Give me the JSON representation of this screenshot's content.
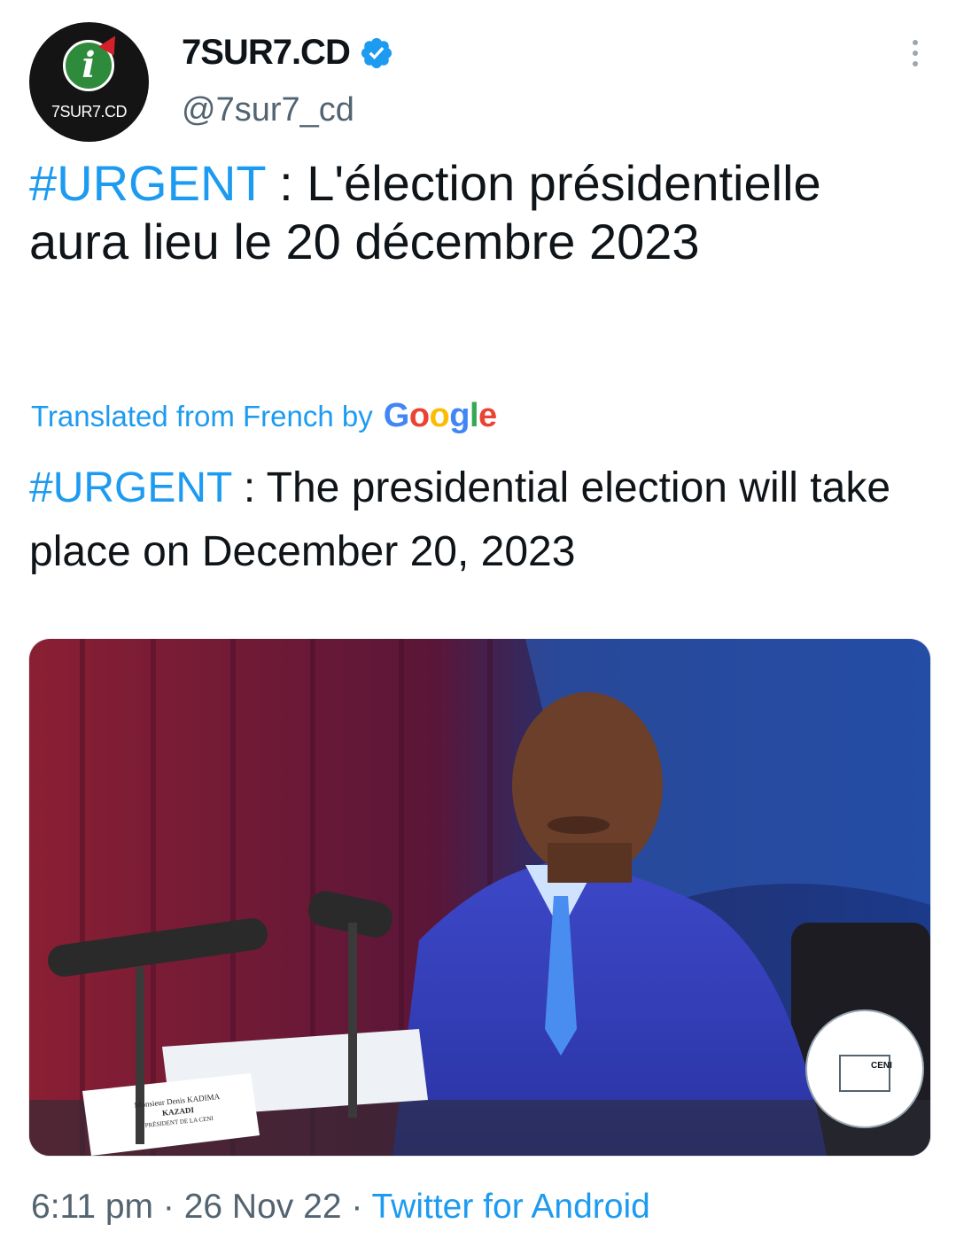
{
  "account": {
    "display_name": "7SUR7.CD",
    "handle": "@7sur7_cd",
    "avatar_text": "7SUR7.CD",
    "verified": true
  },
  "tweet": {
    "original_hashtag": "#URGENT",
    "original_text": " : L'élection présidentielle aura lieu le 20 décembre 2023",
    "translation_label": "Translated from French by",
    "translation_provider": "Google",
    "translated_hashtag": "#URGENT",
    "translated_text": " : The presidential election will take place on December 20, 2023"
  },
  "media": {
    "nameplate_line1": "Monsieur Denis KADIMA",
    "nameplate_line2": "KAZADI",
    "nameplate_line3": "PRÉSIDENT DE LA CENI",
    "seal_text": "CENI"
  },
  "meta": {
    "time": "6:11 pm",
    "date": "26 Nov 22",
    "source": "Twitter for Android",
    "separator": "·"
  },
  "colors": {
    "accent": "#1d9bf0",
    "text": "#0f1419",
    "secondary": "#536471"
  },
  "icons": [
    "avatar-logo-icon",
    "verified-badge-icon",
    "more-options-icon"
  ]
}
